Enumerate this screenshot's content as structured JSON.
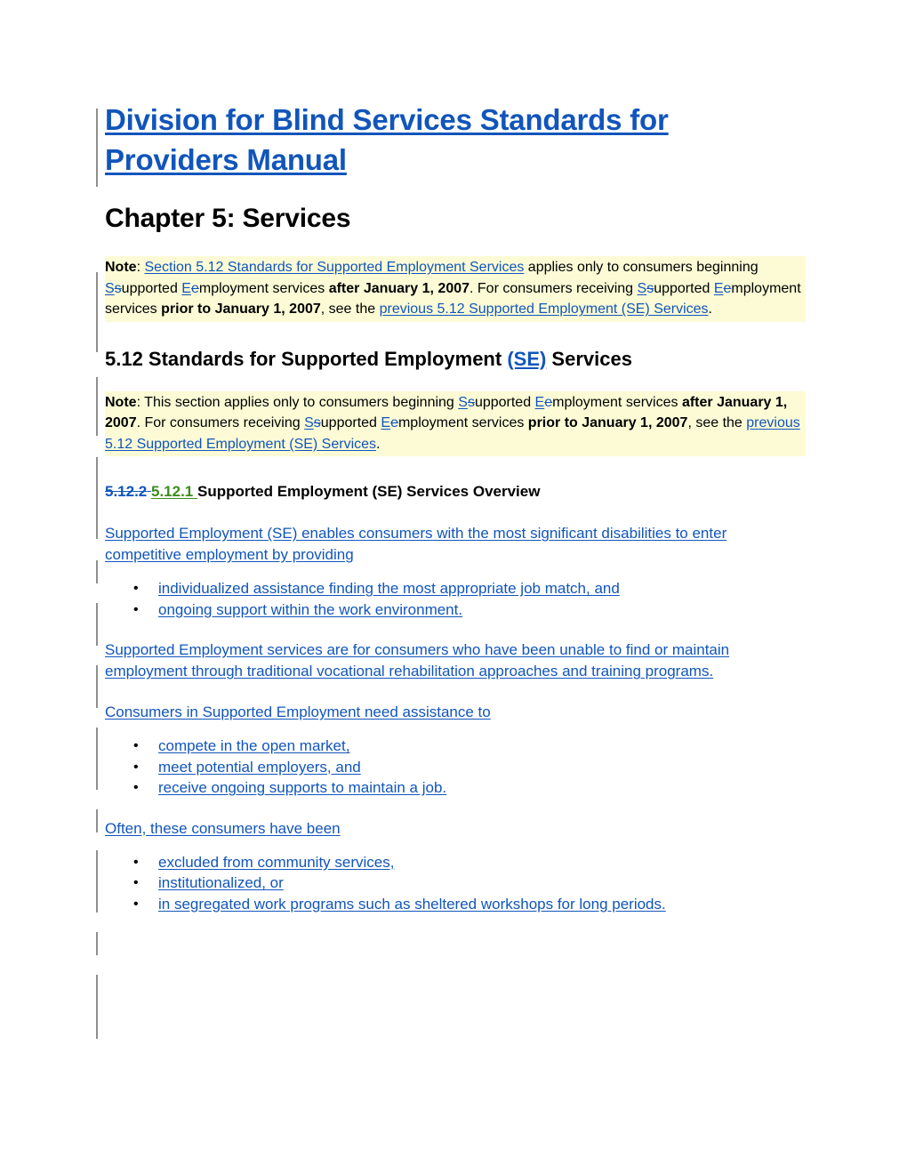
{
  "document": {
    "title": "Division for Blind Services Standards for Providers Manual",
    "chapter": "Chapter 5: Services"
  },
  "colors": {
    "insertion_blue": "#1155bb",
    "insertion_green": "#3c8c1e",
    "deletion_blue": "#1155bb",
    "highlight_yellow": "#fcfbd6",
    "change_bar_gray": "#8f8f8f",
    "body_black": "#000000"
  },
  "note_top": {
    "label": "Note",
    "colon": ": ",
    "link1": "Section 5.12 Standards for Supported Employment Services",
    "t1": " applies only to consumers beginning ",
    "ins_s": "S",
    "del_s": "s",
    "t2": "upported ",
    "ins_e": "E",
    "del_e": "e",
    "t3": "mployment services ",
    "bold1": "after January 1, 2007",
    "t4": ". For consumers receiving ",
    "t5": "upported ",
    "t6": "mployment services ",
    "bold2": "prior to January 1, 2007",
    "t7": ", see the ",
    "link2": "previous 5.12 Supported Employment (SE) Services",
    "t8": "."
  },
  "section_heading": {
    "text_before": "5.12 Standards for Supported Employment ",
    "inserted": "(SE)",
    "text_after": " Services",
    "trailing_space": " "
  },
  "note_second": {
    "label": "Note",
    "colon": ": ",
    "t1": "This section applies only to consumers beginning ",
    "ins_s": "S",
    "del_s": "s",
    "t2": "upported ",
    "ins_e": "E",
    "del_e": "e",
    "t3": "mployment services ",
    "bold1": "after January 1, 2007",
    "t4": ". For consumers receiving ",
    "t5": "upported ",
    "t6": "mployment services ",
    "bold2": "prior to January 1, 2007",
    "t7": ", see the ",
    "link2": "previous 5.12 Supported Employment (SE) Services",
    "t8": "."
  },
  "subsection": {
    "deleted_number": "5.12.2",
    "inserted_number": "5.12.1",
    "title": "Supported Employment (SE) Services Overview"
  },
  "paragraphs": {
    "p1": "Supported Employment (SE) enables consumers with the most significant disabilities to enter competitive employment by providing",
    "p2": "Supported Employment services are for consumers who have been unable to find or maintain employment through traditional vocational rehabilitation approaches and training programs. ",
    "p3": "Consumers in Supported Employment need assistance to",
    "p4": "Often, these consumers have been"
  },
  "bullets": {
    "marker": "•",
    "list1": [
      "individualized assistance finding the most appropriate job match, and ",
      "ongoing support within the work environment. "
    ],
    "list2": [
      "compete in the open market, ",
      "meet potential employers, and ",
      "receive ongoing supports to maintain a job. "
    ],
    "list3": [
      "excluded from community services, ",
      "institutionalized, or ",
      "in segregated work programs such as sheltered workshops for long periods."
    ]
  }
}
